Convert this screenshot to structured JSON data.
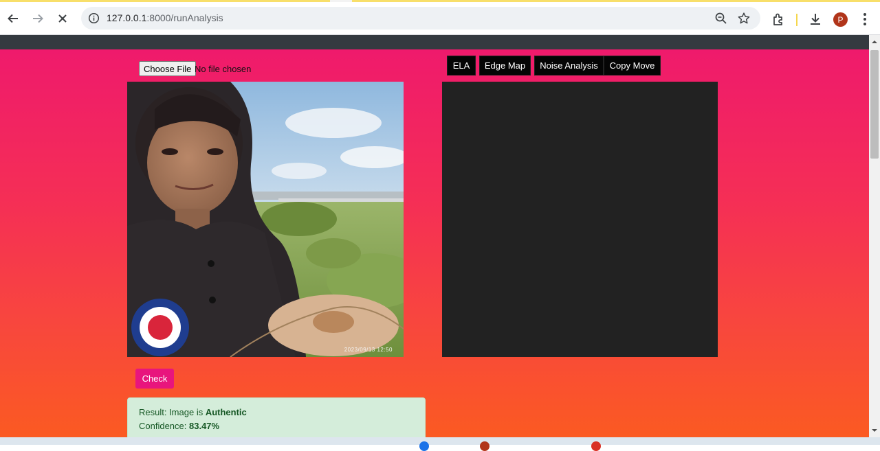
{
  "browser": {
    "url_host": "127.0.0.1",
    "url_path": ":8000/runAnalysis",
    "profile_initial": "P"
  },
  "upload": {
    "choose_label": "Choose File",
    "status": "No file chosen"
  },
  "photo": {
    "timestamp": "2023/09/13 12:50"
  },
  "analysis_tabs": [
    {
      "label": "ELA"
    },
    {
      "label": "Edge Map"
    },
    {
      "label": "Noise Analysis"
    },
    {
      "label": "Copy Move"
    }
  ],
  "check_label": "Check",
  "result": {
    "result_prefix": "Result: Image is ",
    "result_value": "Authentic",
    "confidence_prefix": "Confidence: ",
    "confidence_value": "83.47%"
  },
  "colors": {
    "nav": "#343a40",
    "gradient_top": "#ef1a6c",
    "gradient_bottom": "#fb5a22",
    "check_button": "#e8157d",
    "result_bg": "#d4edda",
    "result_text": "#155724"
  }
}
